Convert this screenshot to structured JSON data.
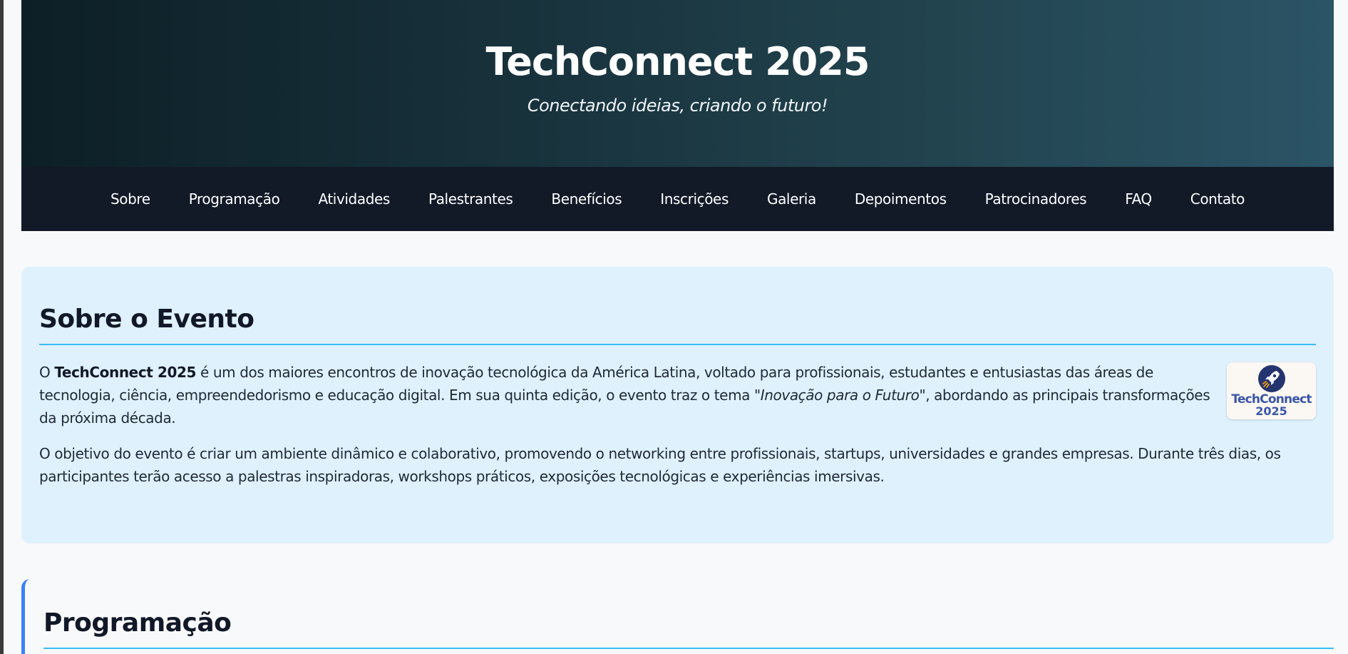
{
  "header": {
    "title": "TechConnect 2025",
    "subtitle": "Conectando ideias, criando o futuro!"
  },
  "nav": {
    "items": [
      "Sobre",
      "Programação",
      "Atividades",
      "Palestrantes",
      "Benefícios",
      "Inscrições",
      "Galeria",
      "Depoimentos",
      "Patrocinadores",
      "FAQ",
      "Contato"
    ]
  },
  "about": {
    "title": "Sobre o Evento",
    "p1_prefix": "O ",
    "p1_brand": "TechConnect 2025",
    "p1_mid": " é um dos maiores encontros de inovação tecnológica da América Latina, voltado para profissionais, estudantes e entusiastas das áreas de tecnologia, ciência, empreendedorismo e educação digital. Em sua quinta edição, o evento traz o tema ",
    "p1_theme": "\"Inovação para o Futuro\"",
    "p1_suffix": ", abordando as principais transformações da próxima década.",
    "p2": "O objetivo do evento é criar um ambiente dinâmico e colaborativo, promovendo o networking entre profissionais, startups, universidades e grandes empresas. Durante três dias, os participantes terão acesso a palestras inspiradoras, workshops práticos, exposições tecnológicas e experiências imersivas.",
    "logo": {
      "name": "TechConnect",
      "year": "2025",
      "icon": "rocket-icon"
    }
  },
  "schedule": {
    "title": "Programação"
  },
  "colors": {
    "nav_bg": "#121a28",
    "about_bg": "#dff1fc",
    "accent_line": "#38bdf8",
    "schedule_accent": "#3b82f6",
    "logo_text": "#3a56a8"
  }
}
